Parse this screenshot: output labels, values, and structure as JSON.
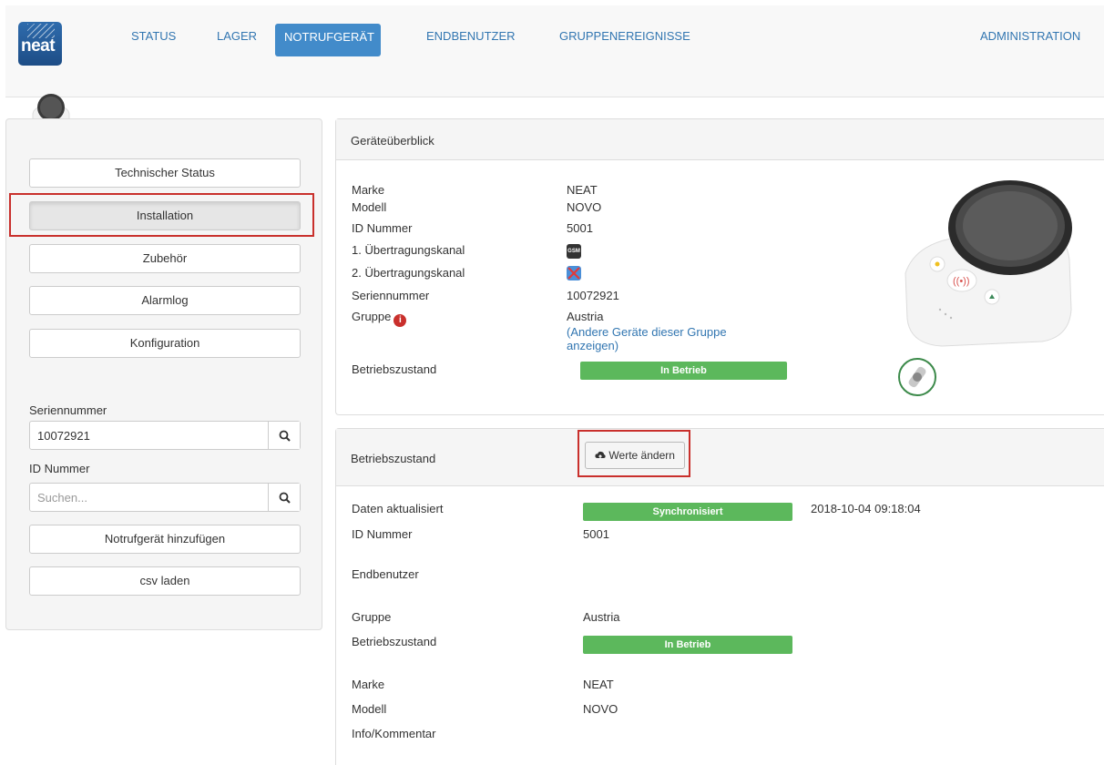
{
  "nav": {
    "logo_text": "neat",
    "items": [
      {
        "label": "STATUS",
        "active": false
      },
      {
        "label": "LAGER",
        "active": false
      },
      {
        "label": "NOTRUFGERÄT",
        "active": true
      },
      {
        "label": "ENDBENUTZER",
        "active": false
      },
      {
        "label": "GRUPPENEREIGNISSE",
        "active": false
      }
    ],
    "admin": "ADMINISTRATION"
  },
  "sidebar": {
    "buttons": [
      "Technischer Status",
      "Installation",
      "Zubehör",
      "Alarmlog",
      "Konfiguration"
    ],
    "active_button": "Installation",
    "serial_label": "Seriennummer",
    "serial_value": "10072921",
    "id_label": "ID Nummer",
    "id_placeholder": "Suchen...",
    "add_button": "Notrufgerät hinzufügen",
    "csv_button": "csv laden"
  },
  "overview": {
    "title": "Geräteüberblick",
    "rows": [
      {
        "key": "Marke",
        "value": "NEAT"
      },
      {
        "key": "Modell",
        "value": "NOVO"
      },
      {
        "key": "ID Nummer",
        "value": "5001"
      },
      {
        "key": "1. Übertragungskanal",
        "value": "GSM"
      },
      {
        "key": "2. Übertragungskanal",
        "value": ""
      },
      {
        "key": "Seriennummer",
        "value": "10072921"
      },
      {
        "key": "Gruppe",
        "value": "Austria"
      }
    ],
    "group_link": "(Andere Geräte dieser Gruppe anzeigen)",
    "status_key": "Betriebszustand",
    "status_value": "In Betrieb",
    "info_icon": "i"
  },
  "state": {
    "title": "Betriebszustand",
    "edit_button": "Werte ändern",
    "updated_key": "Daten aktualisiert",
    "updated_badge": "Synchronisiert",
    "updated_time": "2018-10-04 09:18:04",
    "rows": [
      {
        "key": "ID Nummer",
        "value": "5001"
      },
      {
        "key": "Endbenutzer",
        "value": ""
      },
      {
        "key": "Gruppe",
        "value": "Austria"
      },
      {
        "key": "Betriebszustand",
        "value": "In Betrieb"
      },
      {
        "key": "Marke",
        "value": "NEAT"
      },
      {
        "key": "Modell",
        "value": "NOVO"
      },
      {
        "key": "Info/Kommentar",
        "value": ""
      }
    ]
  },
  "colors": {
    "primary": "#428bca",
    "success": "#5cb85c",
    "highlight": "#c9302c"
  }
}
